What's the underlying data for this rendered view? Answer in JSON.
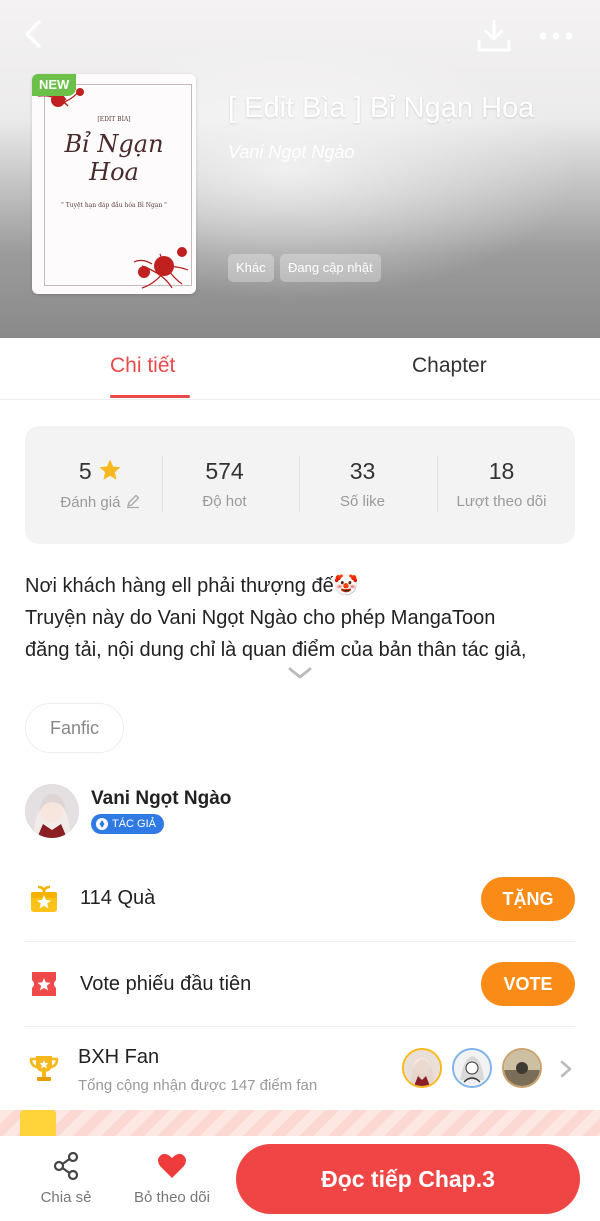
{
  "header": {
    "new_badge": "NEW",
    "title": "[ Edit Bìa ] Bỉ Ngạn Hoa",
    "author": "Vani Ngọt Ngào",
    "tags": [
      "Khác",
      "Đang cập nhật"
    ],
    "cover": {
      "small_top": "[EDIT BÌA]",
      "big_title": "Bỉ Ngạn Hoa",
      "small_bottom": "\" Tuyệt hạn đáp đầu hóa Bỉ Ngạn \""
    }
  },
  "tabs": [
    {
      "label": "Chi tiết",
      "active": true
    },
    {
      "label": "Chapter",
      "active": false
    }
  ],
  "stats": [
    {
      "value": "5",
      "label": "Đánh giá"
    },
    {
      "value": "574",
      "label": "Độ hot"
    },
    {
      "value": "33",
      "label": "Số like"
    },
    {
      "value": "18",
      "label": "Lượt theo dõi"
    }
  ],
  "description": {
    "line1": "Nơi khách hàng ell phải thượng đế🤡",
    "line2": "Truyện này do Vani Ngọt Ngào cho phép MangaToon",
    "line3": "đăng tải, nội dung chỉ là quan điểm của bản thân tác giả,"
  },
  "genre": "Fanfic",
  "author": {
    "name": "Vani Ngọt Ngào",
    "badge": "TÁC GIẢ"
  },
  "gift": {
    "text": "114  Quà",
    "button": "TẶNG"
  },
  "vote": {
    "text": "Vote phiếu đầu tiên",
    "button": "VOTE"
  },
  "fan_rank": {
    "title": "BXH Fan",
    "subtitle": "Tổng cộng nhận được 147 điểm fan"
  },
  "bottom": {
    "share": "Chia sẻ",
    "unfollow": "Bỏ theo dõi",
    "read": "Đọc tiếp Chap.3"
  },
  "colors": {
    "accent_red": "#e94a4a",
    "button_orange": "#fa8b16",
    "read_button": "#f04545",
    "star": "#f6b81c",
    "author_badge": "#2f7ae5"
  }
}
